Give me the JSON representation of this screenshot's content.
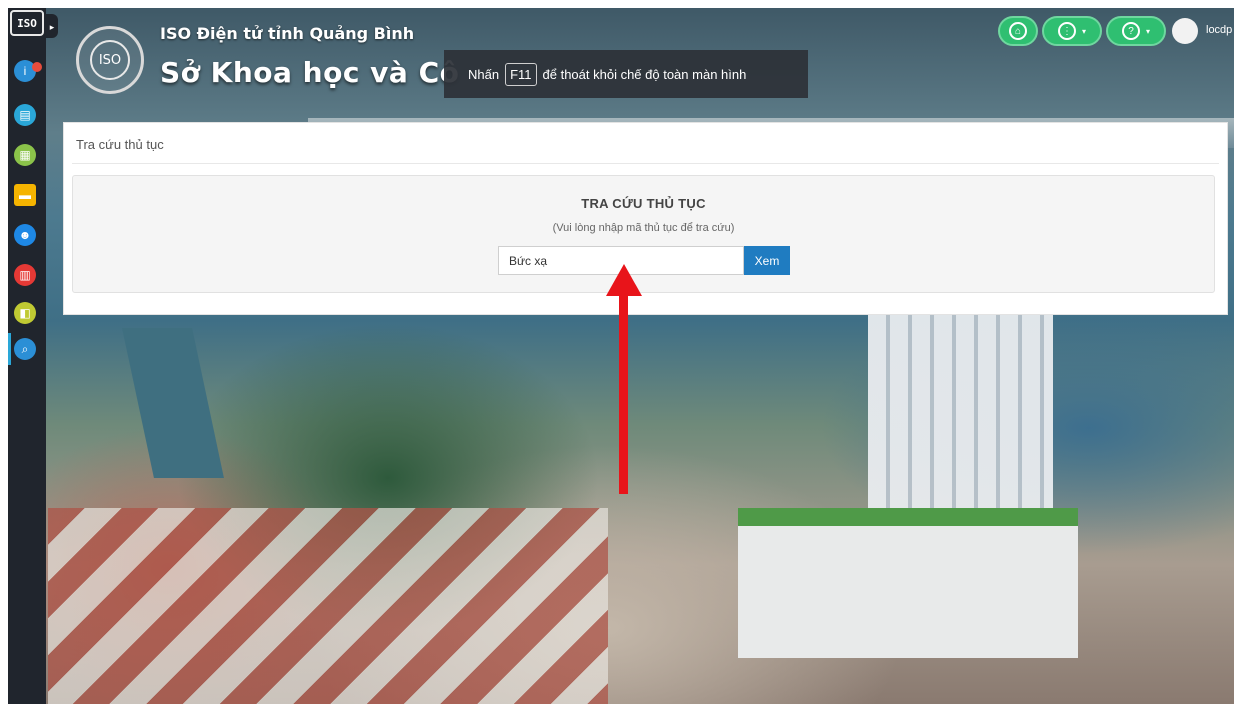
{
  "sidebar": {
    "badge": "ISO",
    "icons": [
      {
        "name": "info-icon",
        "color": "#2b8fd6"
      },
      {
        "name": "document-icon",
        "color": "#2aa7d8"
      },
      {
        "name": "clipboard-icon",
        "color": "#8bc34a"
      },
      {
        "name": "inbox-icon",
        "color": "#f5b400"
      },
      {
        "name": "users-icon",
        "color": "#1e88e5"
      },
      {
        "name": "report-icon",
        "color": "#e53935"
      },
      {
        "name": "archive-icon",
        "color": "#c0ca33"
      },
      {
        "name": "search-icon",
        "color": "#2b8fd6"
      }
    ]
  },
  "header": {
    "subtitle": "ISO Điện tử tỉnh Quảng Bình",
    "title": "Sở Khoa học và Cô",
    "logo_text": "ISO"
  },
  "toast": {
    "prefix": "Nhấn",
    "key": "F11",
    "suffix": "để thoát khỏi chế độ toàn màn hình"
  },
  "toolbar": {
    "user_name": "locdp",
    "accent": "#2fbf71"
  },
  "panel": {
    "breadcrumb": "Tra cứu thủ tục",
    "heading": "TRA CỨU THỦ TỤC",
    "hint": "(Vui lòng nhập mã thủ tục để tra cứu)",
    "input_value": "Bức xạ",
    "button_label": "Xem"
  }
}
